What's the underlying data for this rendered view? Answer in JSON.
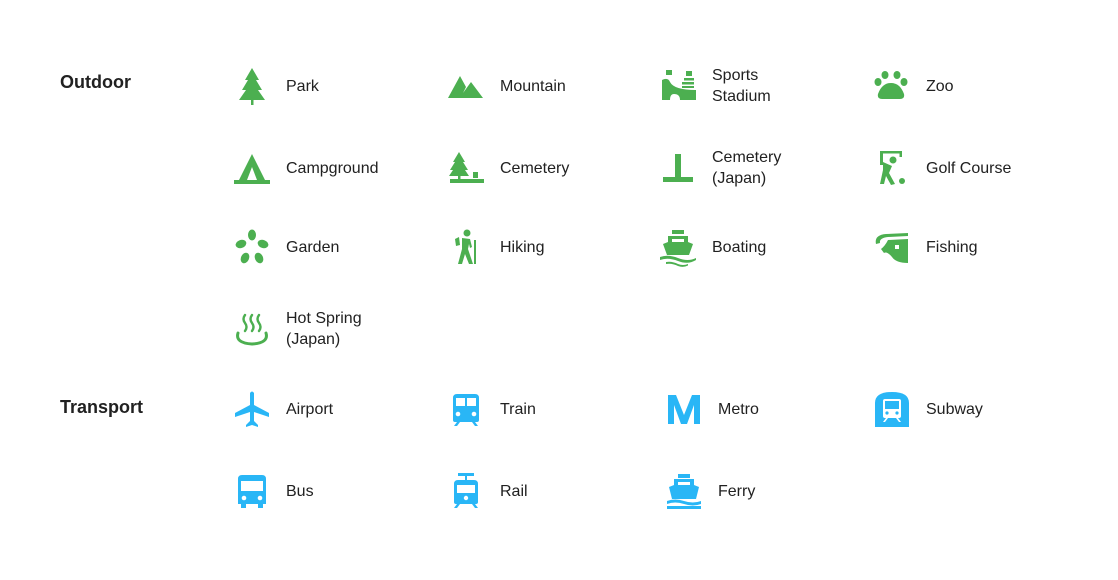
{
  "sections": [
    {
      "title": "Outdoor",
      "color": "#4caf50",
      "items": [
        {
          "label": "Park",
          "icon": "tree-icon"
        },
        {
          "label": "Mountain",
          "icon": "mountain-icon"
        },
        {
          "label": "Sports\nStadium",
          "icon": "stadium-icon"
        },
        {
          "label": "Zoo",
          "icon": "paw-icon"
        },
        {
          "label": "Campground",
          "icon": "tent-icon"
        },
        {
          "label": "Cemetery",
          "icon": "cemetery-tree-icon"
        },
        {
          "label": "Cemetery\n(Japan)",
          "icon": "cemetery-japan-icon"
        },
        {
          "label": "Golf Course",
          "icon": "golfer-icon"
        },
        {
          "label": "Garden",
          "icon": "flower-icon"
        },
        {
          "label": "Hiking",
          "icon": "hiker-icon"
        },
        {
          "label": "Boating",
          "icon": "boat-icon"
        },
        {
          "label": "Fishing",
          "icon": "fish-icon"
        },
        {
          "label": "Hot Spring\n(Japan)",
          "icon": "hot-spring-icon"
        }
      ]
    },
    {
      "title": "Transport",
      "color": "#29b6f6",
      "items": [
        {
          "label": "Airport",
          "icon": "airplane-icon"
        },
        {
          "label": "Train",
          "icon": "train-icon"
        },
        {
          "label": "Metro",
          "icon": "metro-icon"
        },
        {
          "label": "Subway",
          "icon": "subway-icon"
        },
        {
          "label": "Bus",
          "icon": "bus-icon"
        },
        {
          "label": "Rail",
          "icon": "tram-icon"
        },
        {
          "label": "Ferry",
          "icon": "ferry-icon"
        }
      ]
    }
  ]
}
